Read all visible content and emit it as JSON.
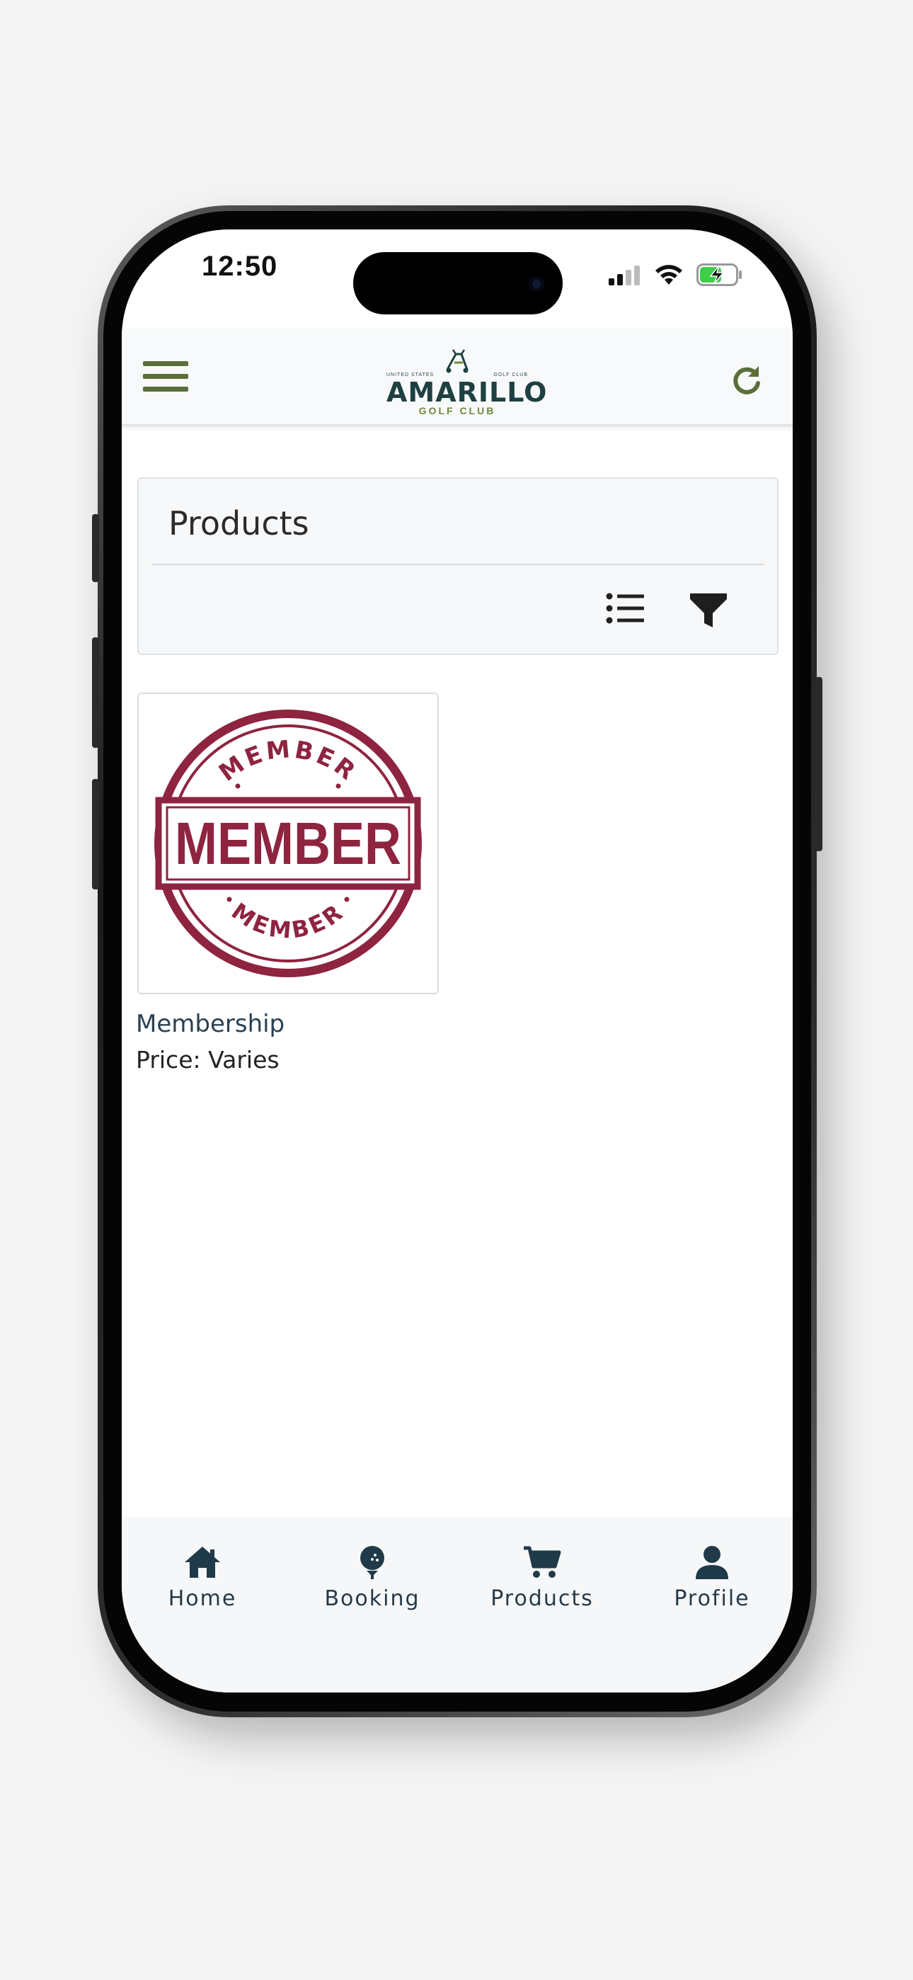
{
  "status_bar": {
    "time": "12:50"
  },
  "header": {
    "logo": {
      "top_text_left": "UNITED STATES",
      "top_text_right": "GOLF CLUB",
      "name": "AMARILLO",
      "sub": "GOLF CLUB"
    }
  },
  "page": {
    "title": "Products"
  },
  "products": [
    {
      "name": "Membership",
      "price": "Price: Varies",
      "image_text": "MEMBER"
    }
  ],
  "tabs": [
    {
      "label": "Home",
      "icon": "home-icon"
    },
    {
      "label": "Booking",
      "icon": "golf-ball-icon"
    },
    {
      "label": "Products",
      "icon": "cart-icon"
    },
    {
      "label": "Profile",
      "icon": "user-icon"
    }
  ],
  "colors": {
    "accent": "#5a6e3a",
    "stamp": "#8e2440",
    "nav_text": "#253a4a",
    "battery": "#3ecf4a"
  }
}
